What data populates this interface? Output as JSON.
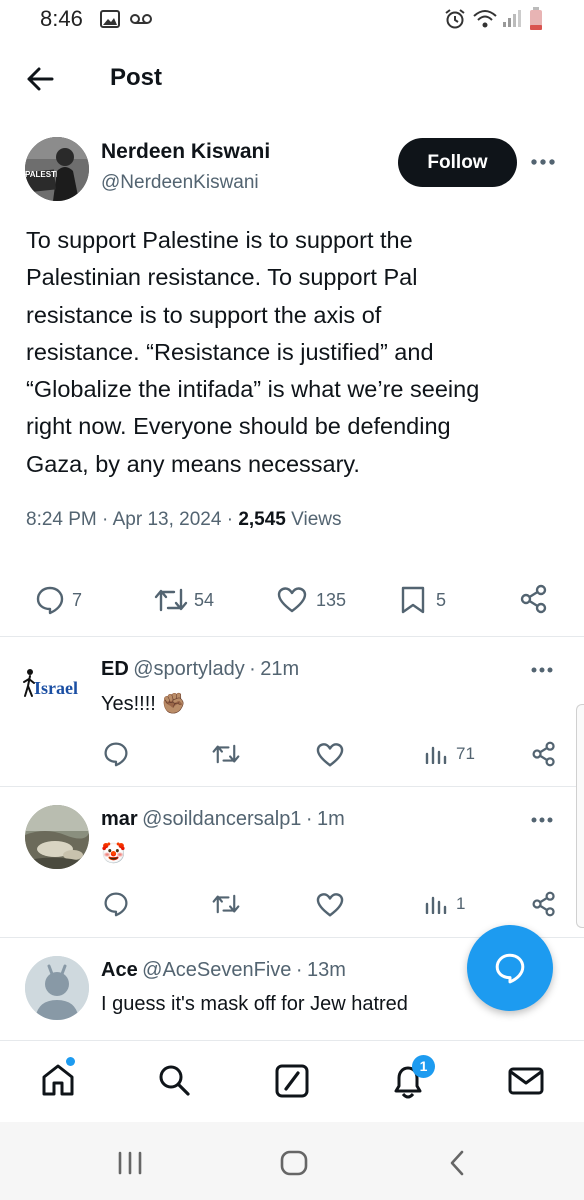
{
  "status_bar": {
    "time": "8:46"
  },
  "header": {
    "title": "Post"
  },
  "post": {
    "author_name": "Nerdeen Kiswani",
    "author_handle": "@NerdeenKiswani",
    "avatar_sign_text": "PALESTINE",
    "follow_label": "Follow",
    "text": "To support Palestine is to support the\nPalestinian resistance. To support Pal\nresistance is to support the axis of\nresistance. “Resistance is justified” and\n“Globalize the intifada” is what we’re seeing\nright now. Everyone should be defending\nGaza, by any means necessary.",
    "time": "8:24 PM",
    "date": "Apr 13, 2024",
    "views_count": "2,545",
    "views_label": "Views",
    "stats": {
      "replies": "7",
      "reposts": "54",
      "likes": "135",
      "bookmarks": "5"
    }
  },
  "replies": [
    {
      "name": "ED",
      "handle": "@sportylady",
      "time": "21m",
      "text": "Yes!!!! ✊🏽",
      "avatar_text": "Israel",
      "views": "71"
    },
    {
      "name": "mar",
      "handle": "@soildancersalp1",
      "time": "1m",
      "text": "🤡",
      "views": "1"
    },
    {
      "name": "Ace",
      "handle": "@AceSevenFive",
      "time": "13m",
      "text": "I guess it's mask off for Jew hatred"
    }
  ],
  "bottom_nav": {
    "notifications_badge": "1"
  },
  "colors": {
    "accent": "#1d9bf0",
    "text": "#0f1419",
    "muted": "#536471",
    "divider": "#e6e9ec"
  },
  "icons": [
    "back-arrow-icon",
    "more-icon",
    "reply-icon",
    "repost-icon",
    "like-icon",
    "bookmark-icon",
    "share-icon",
    "views-icon",
    "home-icon",
    "search-icon",
    "grok-icon",
    "notifications-icon",
    "messages-icon",
    "compose-icon"
  ]
}
